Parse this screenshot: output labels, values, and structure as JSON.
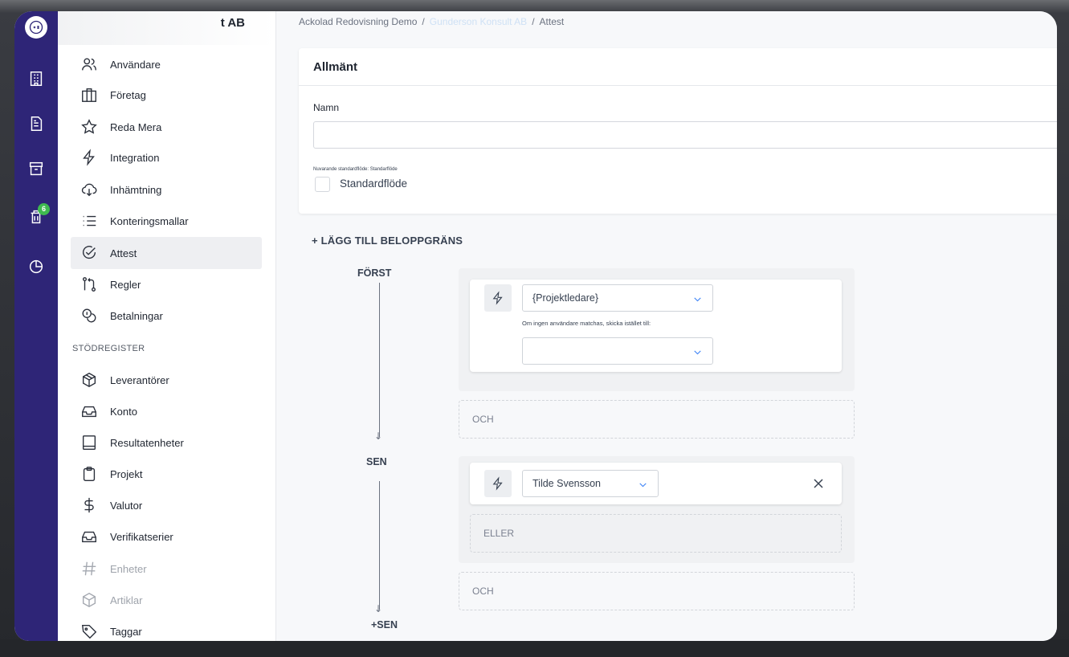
{
  "rail": {
    "badge_count": "6",
    "icons": [
      "logo-icon",
      "building-icon",
      "document-icon",
      "archive-icon",
      "trash-icon",
      "pie-chart-icon"
    ]
  },
  "sidebar": {
    "company_suffix": "t AB",
    "items": [
      {
        "label": "Användare",
        "icon": "users-icon"
      },
      {
        "label": "Företag",
        "icon": "briefcase-icon"
      },
      {
        "label": "Reda Mera",
        "icon": "star-icon"
      },
      {
        "label": "Integration",
        "icon": "bolt-icon"
      },
      {
        "label": "Inhämtning",
        "icon": "cloud-download-icon"
      },
      {
        "label": "Konteringsmallar",
        "icon": "list-icon"
      },
      {
        "label": "Attest",
        "icon": "check-circle-icon",
        "active": true
      },
      {
        "label": "Regler",
        "icon": "git-rules-icon"
      },
      {
        "label": "Betalningar",
        "icon": "coins-icon"
      }
    ],
    "section_label": "STÖDREGISTER",
    "register_items": [
      {
        "label": "Leverantörer",
        "icon": "package-icon"
      },
      {
        "label": "Konto",
        "icon": "inbox-icon"
      },
      {
        "label": "Resultatenheter",
        "icon": "book-icon"
      },
      {
        "label": "Projekt",
        "icon": "clipboard-icon"
      },
      {
        "label": "Valutor",
        "icon": "dollar-icon"
      },
      {
        "label": "Verifikatserier",
        "icon": "inbox-icon"
      },
      {
        "label": "Enheter",
        "icon": "hash-icon",
        "disabled": true
      },
      {
        "label": "Artiklar",
        "icon": "box-icon",
        "disabled": true
      },
      {
        "label": "Taggar",
        "icon": "tag-icon"
      }
    ]
  },
  "breadcrumb": {
    "root": "Ackolad Redovisning Demo",
    "middle": "Gunderson Konsult AB",
    "current": "Attest",
    "separator": "/"
  },
  "general": {
    "title": "Allmänt",
    "name_label": "Namn",
    "name_value": "",
    "default_flow_info": "Nuvarande standardflöde: Standarflöde",
    "default_flow_checkbox_label": "Standardflöde"
  },
  "flow": {
    "add_limit_label": "+ LÄGG TILL BELOPPGRÄNS",
    "first_label": "FÖRST",
    "then_label": "SEN",
    "first_approver": {
      "selected": "{Projektledare}",
      "fallback_hint": "Om ingen användare matchas, skicka istället till:",
      "fallback_value": ""
    },
    "first_and_label": "OCH",
    "then_approver": {
      "selected": "Tilde Svensson"
    },
    "or_label": "ELLER",
    "then_and_label": "OCH",
    "add_then_label": "+SEN"
  },
  "colors": {
    "rail": "#2e2577",
    "badge": "#3fb950",
    "chevron": "#3b82f6"
  }
}
